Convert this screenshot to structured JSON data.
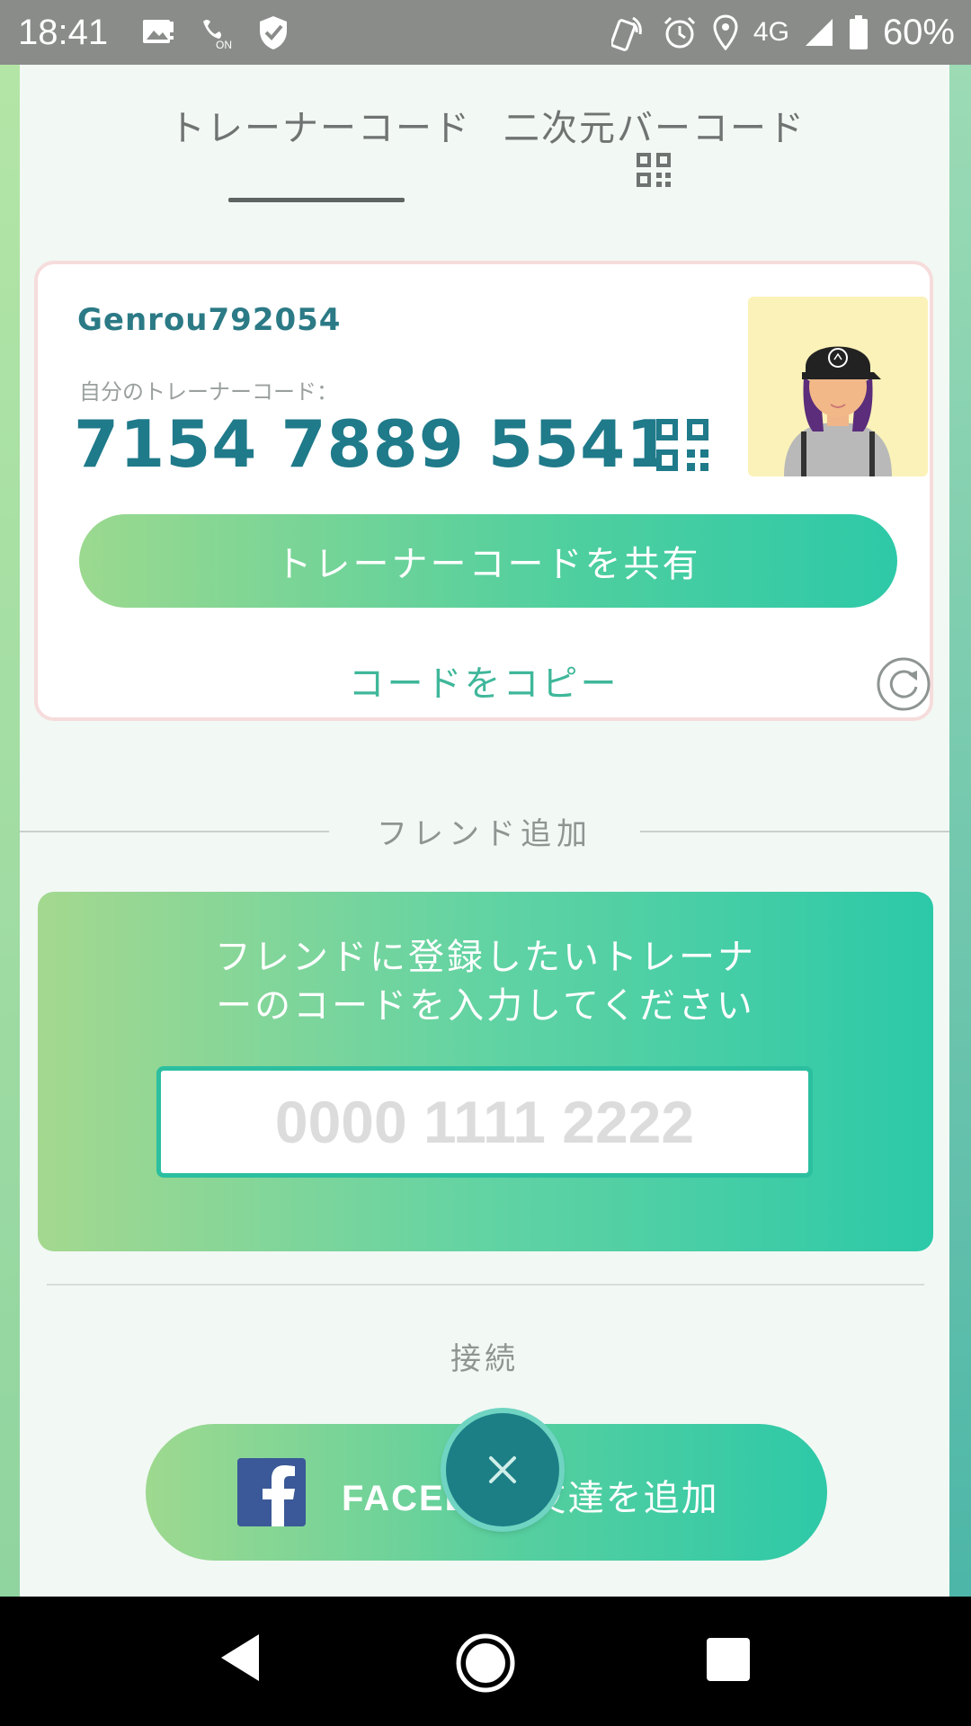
{
  "status_bar": {
    "time": "18:41",
    "network": "4G",
    "battery": "60%",
    "icons_left": [
      "image-icon",
      "wifi-calling-icon",
      "shield-icon"
    ],
    "icons_right": [
      "nfc-icon",
      "alarm-icon",
      "location-icon",
      "signal-icon",
      "battery-icon"
    ]
  },
  "tabs": [
    {
      "label": "トレーナーコード",
      "selected": true
    },
    {
      "label": "二次元バーコード",
      "selected": false
    }
  ],
  "trainer_card": {
    "username": "Genrou792054",
    "code_label": "自分のトレーナーコード：",
    "code": "7154 7889 5541",
    "share_button": "トレーナーコードを共有",
    "copy_link": "コードをコピー"
  },
  "add_friend": {
    "section_title": "フレンド追加",
    "prompt": "フレンドに登録したいトレーナーのコードを入力してください",
    "input_placeholder": "0000 1111 2222",
    "input_value": ""
  },
  "connect": {
    "section_title": "接続",
    "facebook_button_visible_start": "FACEB",
    "facebook_button_visible_end": "友達を追加"
  },
  "colors": {
    "accent_teal": "#1f7a8a",
    "button_gradient_start": "#9bd98f",
    "button_gradient_end": "#2ec9a8",
    "facebook_blue": "#3b5998"
  }
}
